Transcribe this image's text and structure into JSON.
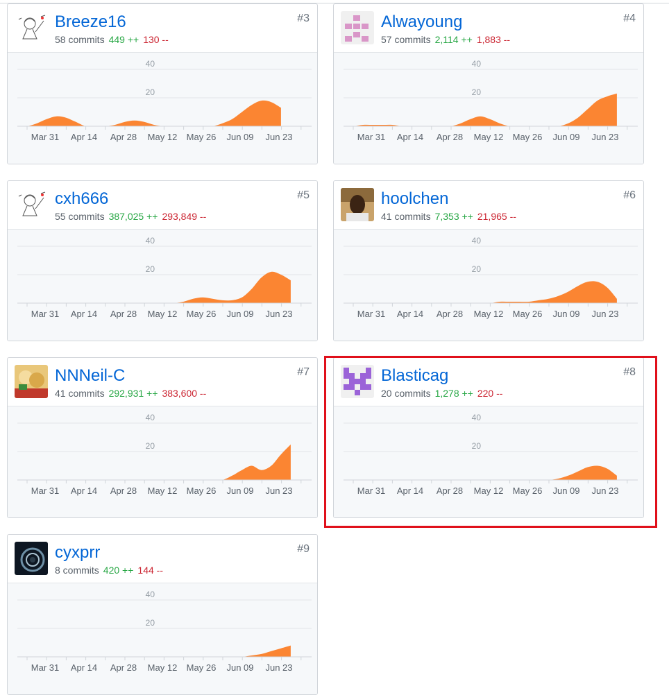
{
  "x_labels": [
    "Mar 31",
    "Apr 14",
    "Apr 28",
    "May 12",
    "May 26",
    "Jun 09",
    "Jun 23"
  ],
  "y_labels": [
    "40",
    "20"
  ],
  "y_max": 40,
  "area_color": "#fb8532",
  "highlight_color": "#e0101b",
  "contributors": [
    {
      "rank": "#3",
      "login": "Breeze16",
      "commits": "58 commits",
      "additions": "449 ++",
      "deletions": "130 --",
      "avatar": "sketch",
      "weeks": [
        0,
        0,
        2,
        5,
        7,
        6,
        3,
        0,
        0,
        0,
        1,
        3,
        4,
        3,
        1,
        0,
        0,
        0,
        0,
        0,
        0,
        2,
        5,
        10,
        15,
        18,
        17,
        13
      ]
    },
    {
      "rank": "#4",
      "login": "Alwayoung",
      "commits": "57 commits",
      "additions": "2,114 ++",
      "deletions": "1,883 --",
      "avatar": "identicon-pink",
      "weeks": [
        0,
        0,
        1,
        1,
        1,
        1,
        0,
        0,
        0,
        0,
        0,
        0,
        2,
        5,
        7,
        5,
        2,
        0,
        0,
        0,
        0,
        0,
        0,
        2,
        6,
        12,
        18,
        21,
        23
      ]
    },
    {
      "rank": "#5",
      "login": "cxh666",
      "commits": "55 commits",
      "additions": "387,025 ++",
      "deletions": "293,849 --",
      "avatar": "sketch",
      "weeks": [
        0,
        0,
        0,
        0,
        0,
        0,
        0,
        0,
        0,
        0,
        0,
        0,
        0,
        0,
        0,
        0,
        0,
        1,
        3,
        4,
        3,
        2,
        2,
        4,
        10,
        18,
        22,
        20,
        16
      ]
    },
    {
      "rank": "#6",
      "login": "hoolchen",
      "commits": "41 commits",
      "additions": "7,353 ++",
      "deletions": "21,965 --",
      "avatar": "photo-person",
      "weeks": [
        0,
        0,
        0,
        0,
        0,
        0,
        0,
        0,
        0,
        0,
        0,
        0,
        0,
        0,
        0,
        0,
        1,
        1,
        1,
        1,
        2,
        3,
        5,
        8,
        12,
        15,
        15,
        11,
        3
      ]
    },
    {
      "rank": "#7",
      "login": "NNNeil-C",
      "commits": "41 commits",
      "additions": "292,931 ++",
      "deletions": "383,600 --",
      "avatar": "photo-anime",
      "weeks": [
        0,
        0,
        0,
        0,
        0,
        0,
        0,
        0,
        0,
        0,
        0,
        0,
        0,
        0,
        0,
        0,
        0,
        0,
        0,
        0,
        0,
        0,
        3,
        7,
        10,
        7,
        10,
        18,
        25
      ]
    },
    {
      "rank": "#8",
      "login": "Blasticag",
      "commits": "20 commits",
      "additions": "1,278 ++",
      "deletions": "220 --",
      "avatar": "identicon-purple",
      "weeks": [
        0,
        0,
        0,
        0,
        0,
        0,
        0,
        0,
        0,
        0,
        0,
        0,
        0,
        0,
        0,
        0,
        0,
        0,
        0,
        0,
        0,
        0,
        1,
        3,
        6,
        9,
        10,
        8,
        3
      ]
    },
    {
      "rank": "#9",
      "login": "cyxprr",
      "commits": "8 commits",
      "additions": "420 ++",
      "deletions": "144 --",
      "avatar": "photo-dark",
      "weeks": [
        0,
        0,
        0,
        0,
        0,
        0,
        0,
        0,
        0,
        0,
        0,
        0,
        0,
        0,
        0,
        0,
        0,
        0,
        0,
        0,
        0,
        0,
        0,
        0,
        1,
        2,
        4,
        6,
        8
      ]
    }
  ]
}
